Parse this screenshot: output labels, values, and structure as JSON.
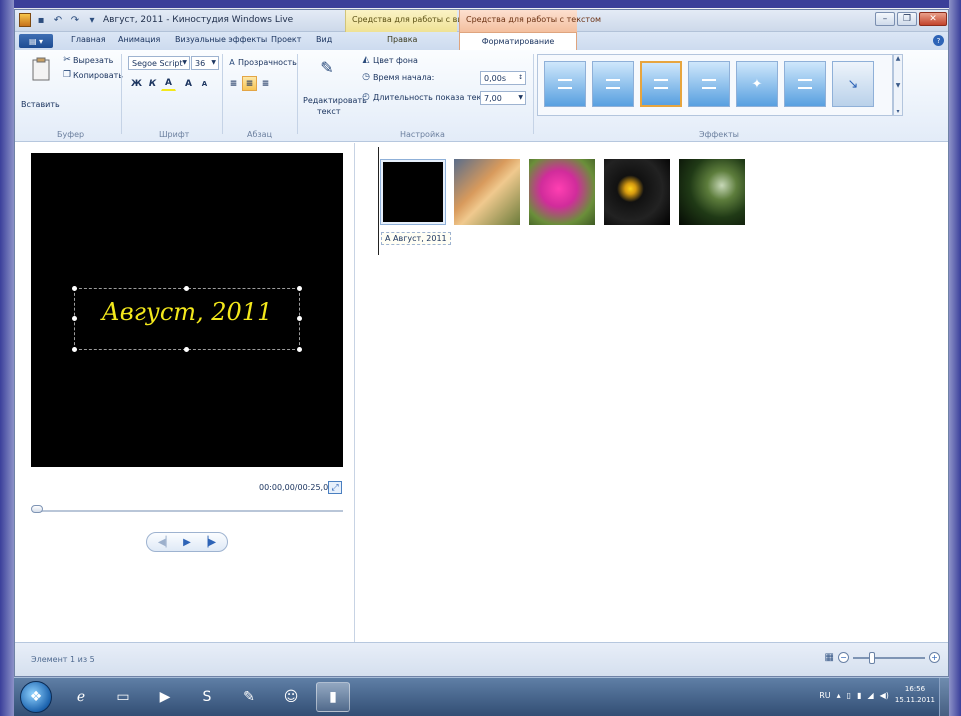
{
  "window": {
    "title": "Август, 2011 - Киностудия Windows Live",
    "context_tabs": {
      "video": "Средства для работы с видео",
      "text": "Средства для работы с текстом"
    }
  },
  "ribbon_tabs": [
    "Главная",
    "Анимация",
    "Визуальные эффекты",
    "Проект",
    "Вид",
    "Правка",
    "Форматирование"
  ],
  "ribbon": {
    "clipboard": {
      "paste": "Вставить",
      "cut": "Вырезать",
      "copy": "Копировать",
      "group": "Буфер"
    },
    "font": {
      "family": "Segoe Script",
      "size": "36",
      "bold": "Ж",
      "italic": "К",
      "color": "A",
      "grow": "A",
      "shrink": "A",
      "group": "Шрифт"
    },
    "paragraph": {
      "transparency": "Прозрачность",
      "group": "Абзац"
    },
    "adjust": {
      "edit_text_line1": "Редактировать",
      "edit_text_line2": "текст",
      "bg_color": "Цвет фона",
      "start_time_label": "Время начала:",
      "start_time_value": "0,00s",
      "duration_label": "Длительность показа текста:",
      "duration_value": "7,00",
      "group": "Настройка"
    },
    "effects": {
      "group": "Эффекты"
    }
  },
  "preview": {
    "title_text": "Август, 2011",
    "timecode": "00:00,00/00:25,00"
  },
  "storyboard": {
    "caption": "Август, 2011"
  },
  "status": {
    "text": "Элемент 1 из 5"
  },
  "taskbar": {
    "lang": "RU",
    "time": "16:56",
    "date": "15.11.2011"
  },
  "colors": {
    "title_text": "#f3e81c",
    "ribbon_accent": "#2d63b6",
    "context_video": "#efe295",
    "context_text": "#f3bf9e"
  }
}
